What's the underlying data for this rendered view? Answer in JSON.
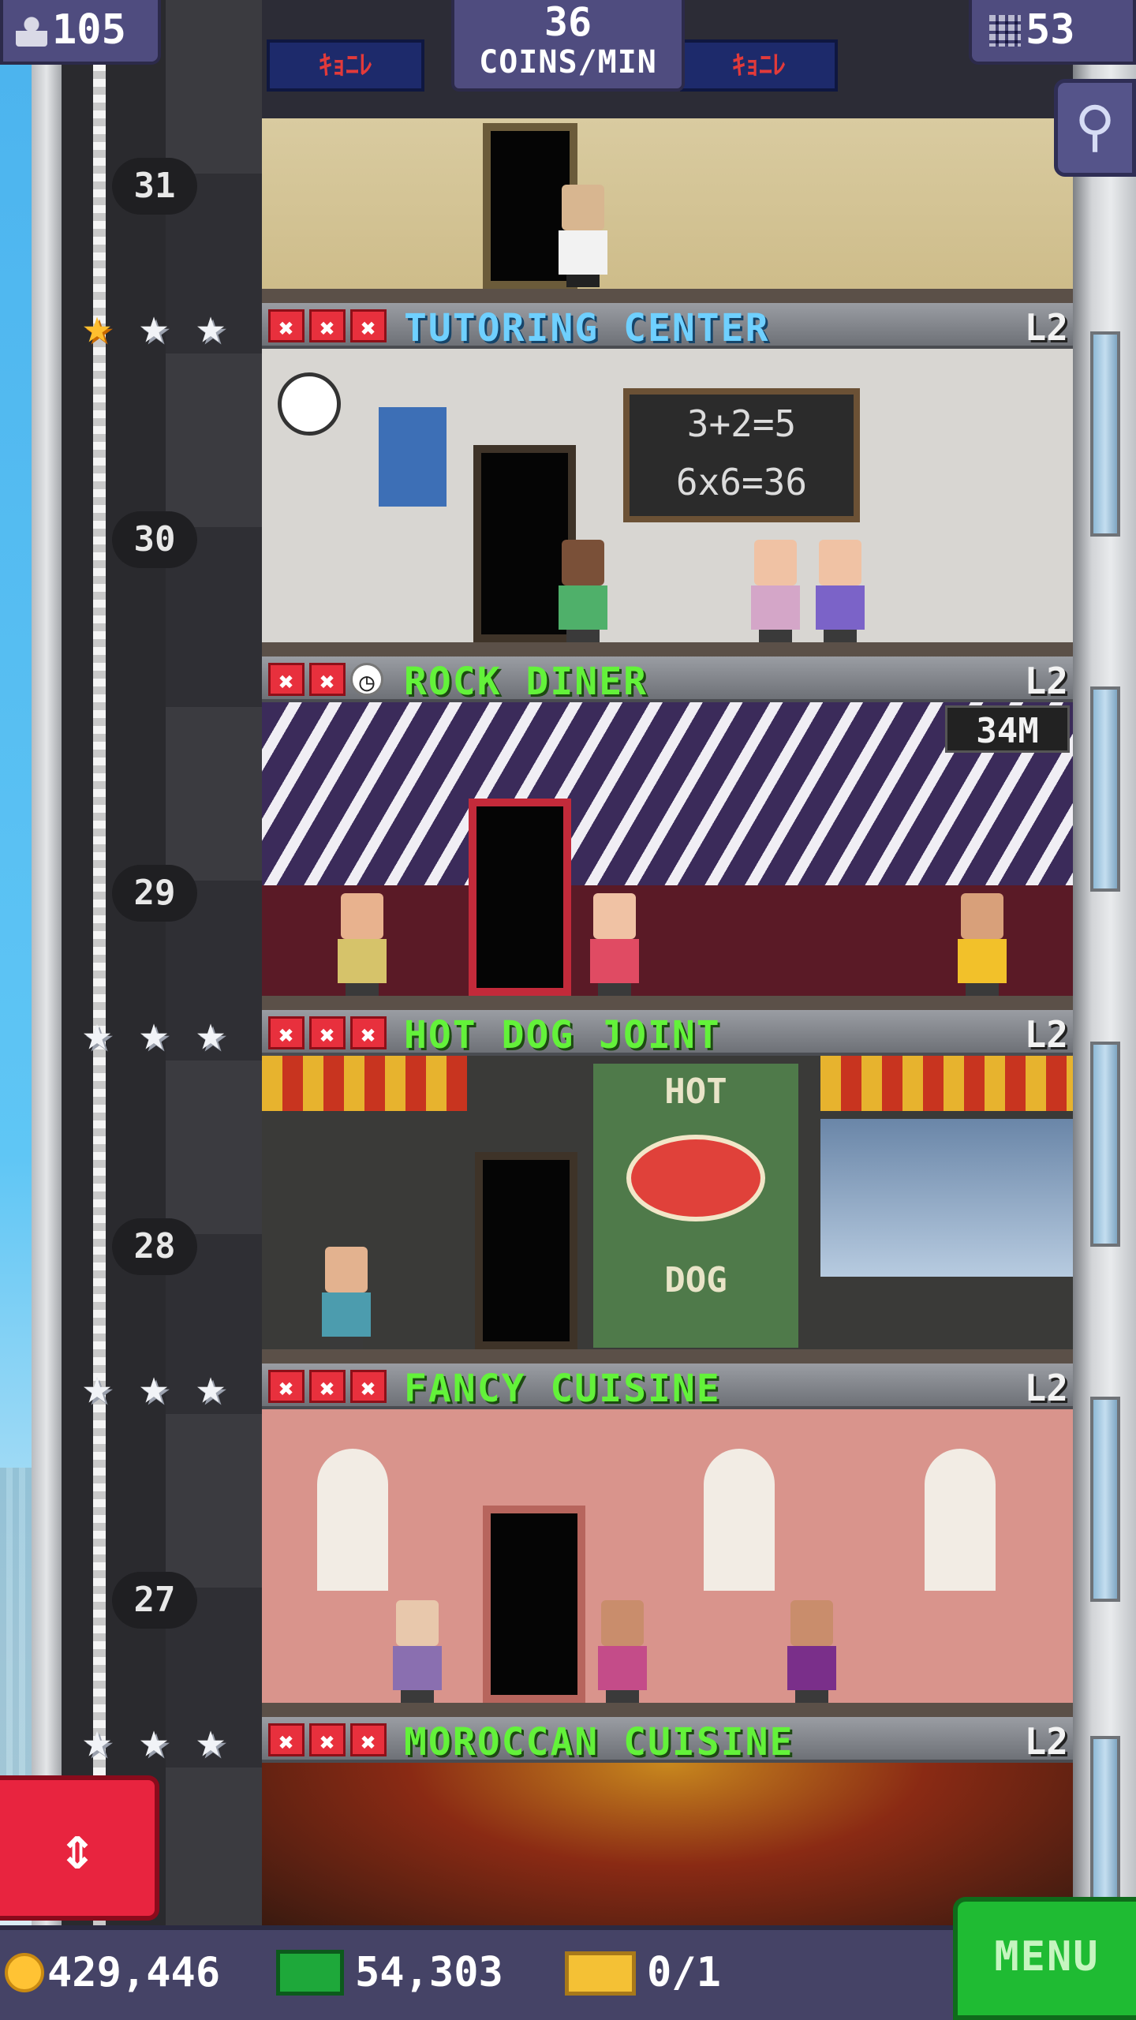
{
  "hud": {
    "population": "105",
    "coins_per_min_value": "36",
    "coins_per_min_label": "COINS/MIN",
    "floors_count": "53"
  },
  "shaft": {
    "floor_numbers": [
      "31",
      "30",
      "29",
      "28",
      "27"
    ]
  },
  "top_floor": {
    "banner_left": "ｷｮﾆﾚ",
    "banner_right": "ｷｮﾆﾚ"
  },
  "floors": [
    {
      "name": "TUTORING CENTER",
      "level": "L2",
      "stars_gold": 1,
      "stars_total": 3,
      "chalkboard_line1": "3+2=5",
      "chalkboard_line2": "6x6=36"
    },
    {
      "name": "ROCK DINER",
      "level": "L2",
      "timer": "34M"
    },
    {
      "name": "HOT DOG JOINT",
      "level": "L2",
      "sign_top": "HOT",
      "sign_bottom": "DOG"
    },
    {
      "name": "FANCY CUISINE",
      "level": "L2"
    },
    {
      "name": "MOROCCAN CUISINE",
      "level": "L2"
    }
  ],
  "bottom_bar": {
    "coins": "429,446",
    "bux": "54,303",
    "tickets": "0/1",
    "menu_label": "MENU"
  },
  "icons": {
    "elevator": "up-down-arrows-icon",
    "zoom": "magnifier-minus-icon",
    "population": "person-icon",
    "floors": "building-icon"
  },
  "colors": {
    "floor_name_green": "#63f23a",
    "floor_name_blue": "#6fd0ff",
    "badge_red": "#e8303d",
    "menu_green": "#1fbb33",
    "elevator_red": "#e8243f",
    "hud_purple": "#4f4c7f"
  }
}
